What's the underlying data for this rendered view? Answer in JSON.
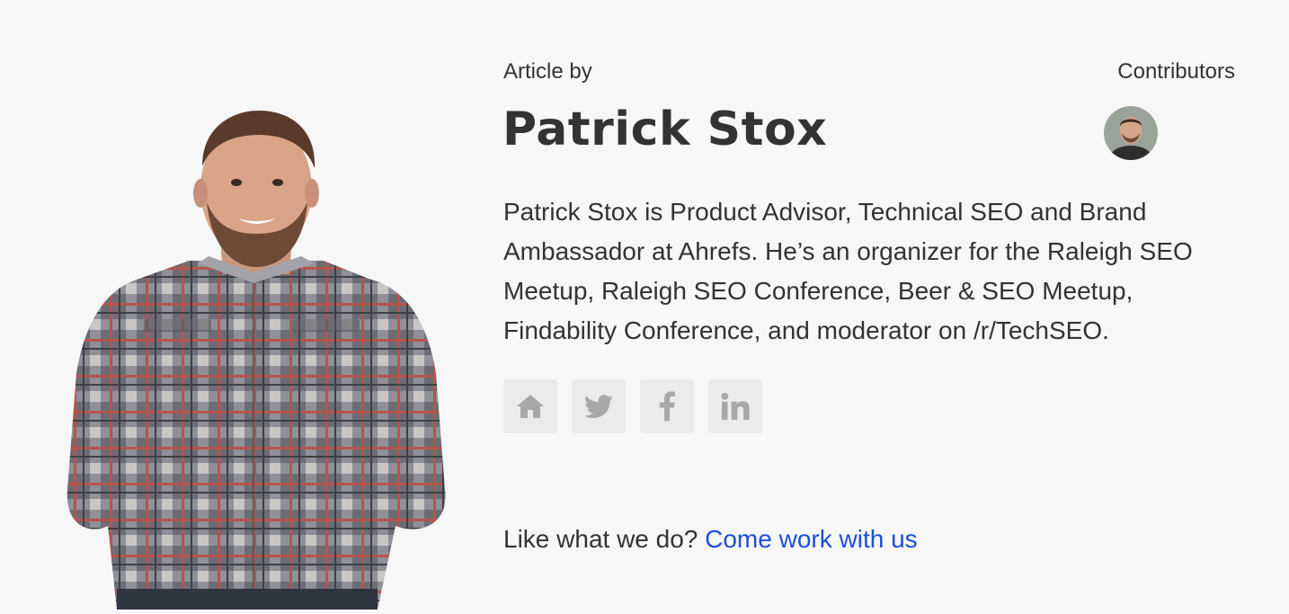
{
  "author": {
    "article_by_label": "Article by",
    "name": "Patrick Stox",
    "bio": "Patrick Stox is Product Advisor, Technical SEO and Brand Ambassador at Ahrefs. He’s an organizer for the Raleigh SEO Meetup, Raleigh SEO Conference, Beer & SEO Meetup, Findability Conference, and moderator on /r/TechSEO.",
    "photo_icon": "author-photo"
  },
  "contributors": {
    "label": "Contributors",
    "avatar_icon": "contributor-avatar"
  },
  "social_links": [
    {
      "icon": "home-icon"
    },
    {
      "icon": "twitter-icon"
    },
    {
      "icon": "facebook-icon"
    },
    {
      "icon": "linkedin-icon"
    }
  ],
  "cta": {
    "text": "Like what we do?",
    "link_text": "Come work with us"
  },
  "colors": {
    "background": "#f7f7f7",
    "text": "#333333",
    "link": "#1b4fd6",
    "social_button_bg": "#ebebeb",
    "social_icon": "#a8a8a8"
  }
}
